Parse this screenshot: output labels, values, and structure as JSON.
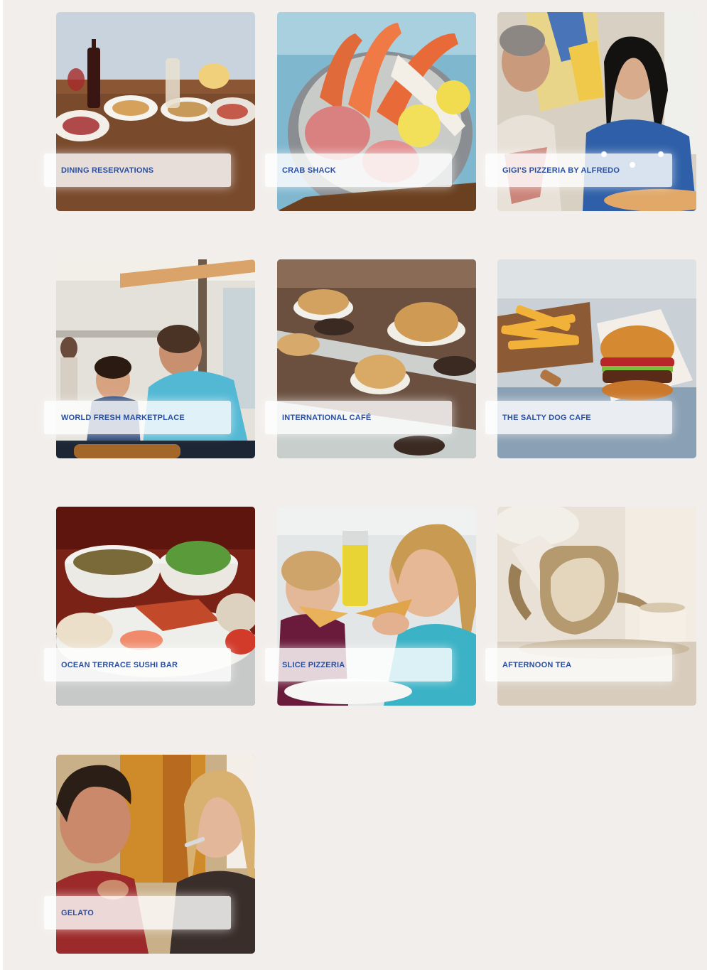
{
  "colors": {
    "page_background": "#f1eeeb",
    "label_text": "#2a4fa0",
    "label_background": "#ffffff"
  },
  "tiles": [
    {
      "label": "DINING RESERVATIONS",
      "image": "restaurant-table-dishes-photo"
    },
    {
      "label": "CRAB SHACK",
      "image": "crab-legs-bucket-photo"
    },
    {
      "label": "GIGI'S PIZZERIA BY ALFREDO",
      "image": "couple-laughing-pizzeria-photo"
    },
    {
      "label": "WORLD FRESH MARKETPLACE",
      "image": "father-son-dining-photo"
    },
    {
      "label": "INTERNATIONAL CAFÉ",
      "image": "pastry-display-case-photo"
    },
    {
      "label": "THE SALTY DOG CAFE",
      "image": "burger-and-fries-photo"
    },
    {
      "label": "OCEAN TERRACE SUSHI BAR",
      "image": "sushi-and-bowls-photo"
    },
    {
      "label": "SLICE PIZZERIA",
      "image": "kids-eating-pizza-photo"
    },
    {
      "label": "AFTERNOON TEA",
      "image": "teapot-pouring-photo"
    },
    {
      "label": "GELATO",
      "image": "couple-eating-gelato-photo"
    }
  ]
}
